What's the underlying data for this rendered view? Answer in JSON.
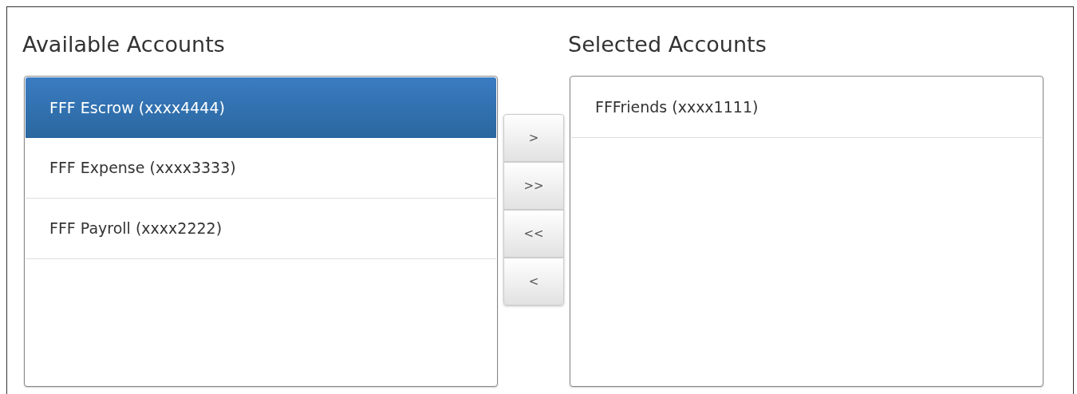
{
  "available": {
    "title": "Available Accounts",
    "items": [
      {
        "label": "FFF Escrow (xxxx4444)",
        "selected": true
      },
      {
        "label": "FFF Expense (xxxx3333)",
        "selected": false
      },
      {
        "label": "FFF Payroll (xxxx2222)",
        "selected": false
      }
    ]
  },
  "move_buttons": [
    ">",
    ">>",
    "<<",
    "<"
  ],
  "selected_accounts": {
    "title": "Selected Accounts",
    "items": [
      {
        "label": "FFFriends (xxxx1111)",
        "selected": false
      }
    ]
  }
}
